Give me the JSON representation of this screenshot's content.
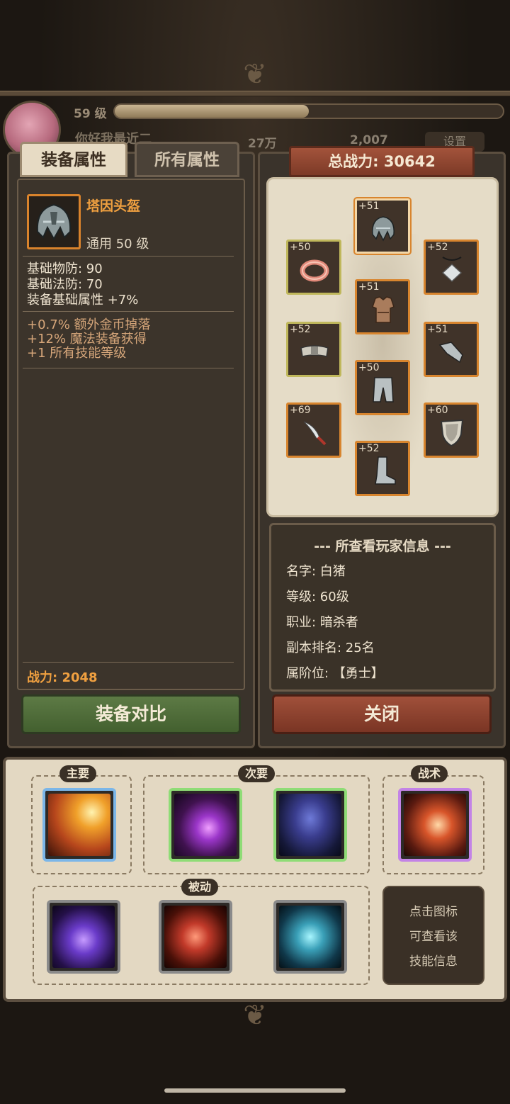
{
  "header": {
    "level": "59 级",
    "xp_fraction": 0.5,
    "name_obscured": "你好我最近二",
    "currency_a": "27万",
    "currency_b": "2,007",
    "settings_label": "设置"
  },
  "tabs": {
    "equip_attr": "装备属性",
    "all_attr": "所有属性"
  },
  "item": {
    "name": "塔因头盔",
    "class_level": "通用  50 级",
    "icon": "helmet-icon",
    "base_stats": [
      "基础物防:  90",
      "基础法防:  70",
      "装备基础属性 +7%"
    ],
    "bonus_stats": [
      "+0.7% 额外金币掉落",
      "+12% 魔法装备获得",
      "+1 所有技能等级"
    ],
    "power": "战力: 2048"
  },
  "buttons": {
    "compare": "装备对比",
    "close": "关闭"
  },
  "total_power": "总战力: 30642",
  "equipment_slots": [
    {
      "level": "+51",
      "icon": "helmet-icon",
      "color": "#d8852e",
      "selected": true
    },
    {
      "level": "+50",
      "icon": "ring-icon",
      "color": "#c0b85c"
    },
    {
      "level": "+52",
      "icon": "amulet-icon",
      "color": "#d8852e"
    },
    {
      "level": "+51",
      "icon": "armor-icon",
      "color": "#d8852e"
    },
    {
      "level": "+52",
      "icon": "belt-icon",
      "color": "#c0b85c"
    },
    {
      "level": "+51",
      "icon": "gauntlet-icon",
      "color": "#d8852e"
    },
    {
      "level": "+50",
      "icon": "pants-icon",
      "color": "#d8852e"
    },
    {
      "level": "+69",
      "icon": "dagger-icon",
      "color": "#d8852e"
    },
    {
      "level": "+60",
      "icon": "shield-icon",
      "color": "#d8852e"
    },
    {
      "level": "+52",
      "icon": "boots-icon",
      "color": "#d8852e"
    }
  ],
  "player_info": {
    "title": "--- 所查看玩家信息 ---",
    "lines": [
      "名字:  白猪",
      "等级:  60级",
      "职业:  暗杀者",
      "副本排名:  25名",
      "属阶位: 【勇士】"
    ]
  },
  "skill_groups": {
    "main": "主要",
    "secondary": "次要",
    "tactic": "战术",
    "passive": "被动"
  },
  "hint": [
    "点击图标",
    "可查看该",
    "技能信息"
  ]
}
